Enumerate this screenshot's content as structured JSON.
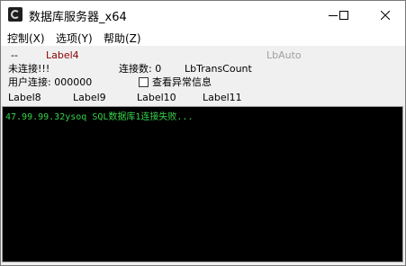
{
  "window": {
    "title": "数据库服务器_x64",
    "buttons": {
      "minimize": "—",
      "maximize": "☐",
      "close": "✕"
    }
  },
  "menu": [
    "控制(X)",
    "选项(Y)",
    "帮助(Z)"
  ],
  "row1": {
    "dash": "--",
    "label4": "Label4",
    "lb_auto": "LbAuto"
  },
  "row2": {
    "status": "未连接!!!",
    "conn_count": "连接数: 0",
    "trans_count": "LbTransCount"
  },
  "row3": {
    "user_conn": "用户连接: 000000",
    "view_error_label": "查看异常信息",
    "view_error_checked": false
  },
  "row4": {
    "label8": "Label8",
    "label9": "Label9",
    "label10": "Label10",
    "label11": "Label11"
  },
  "console": {
    "lines": [
      "47.99.99.32ysoq SQL数据库1连接失败..."
    ]
  },
  "colors": {
    "label4": "#8b0000",
    "lb_auto": "#a0a0a0",
    "console_bg": "#000000",
    "console_text": "#36d24a"
  }
}
